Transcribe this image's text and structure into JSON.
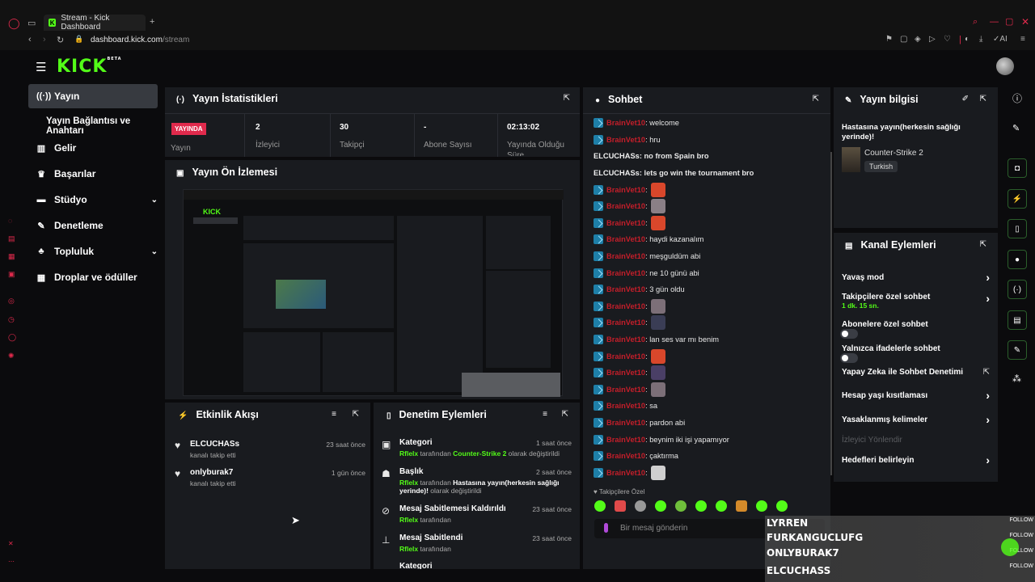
{
  "browser": {
    "tab_title": "Stream - Kick Dashboard",
    "url_host": "dashboard.kick.com",
    "url_path": "/stream",
    "ai_label": "AI"
  },
  "brand": {
    "logo": "KICK",
    "beta": "BETA"
  },
  "sidebar": {
    "items": [
      {
        "label": "Yayın",
        "icon": "broadcast-icon"
      },
      {
        "label": "Yayın Bağlantısı ve Anahtarı"
      },
      {
        "label": "Gelir",
        "icon": "chart-icon"
      },
      {
        "label": "Başarılar",
        "icon": "trophy-icon"
      },
      {
        "label": "Stüdyo",
        "icon": "studio-icon"
      },
      {
        "label": "Denetleme",
        "icon": "wrench-icon"
      },
      {
        "label": "Topluluk",
        "icon": "community-icon"
      },
      {
        "label": "Droplar ve ödüller",
        "icon": "gift-icon"
      }
    ]
  },
  "stats": {
    "title": "Yayın İstatistikleri",
    "live_badge": "YAYINDA",
    "live_label": "Yayın",
    "items": [
      {
        "value": "2",
        "label": "İzleyici"
      },
      {
        "value": "30",
        "label": "Takipçi"
      },
      {
        "value": "-",
        "label": "Abone Sayısı"
      },
      {
        "value": "02:13:02",
        "label": "Yayında Olduğu Süre"
      }
    ]
  },
  "preview": {
    "title": "Yayın Ön İzlemesi"
  },
  "activity": {
    "title": "Etkinlik Akışı",
    "items": [
      {
        "name": "ELCUCHASs",
        "sub": "kanalı takip etti",
        "time": "23 saat önce"
      },
      {
        "name": "onlyburak7",
        "sub": "kanalı takip etti",
        "time": "1 gün önce"
      }
    ]
  },
  "moderation": {
    "title": "Denetim Eylemleri",
    "items": [
      {
        "title": "Kategori",
        "user": "Rflelx",
        "mid": " tarafından ",
        "val": "Counter-Strike 2",
        "tail": " olarak değiştirildi",
        "time": "1 saat önce"
      },
      {
        "title": "Başlık",
        "user": "Rflelx",
        "mid": " tarafından ",
        "val": "Hastasına yayın(herkesin sağlığı yerinde)!",
        "tail": " olarak değiştirildi",
        "time": "2 saat önce"
      },
      {
        "title": "Mesaj Sabitlemesi Kaldırıldı",
        "user": "Rflelx",
        "mid": " tarafından",
        "val": "",
        "tail": "",
        "time": "23 saat önce"
      },
      {
        "title": "Mesaj Sabitlendi",
        "user": "Rflelx",
        "mid": " tarafından",
        "val": "",
        "tail": "",
        "time": "23 saat önce"
      },
      {
        "title": "Kategori",
        "user": "",
        "mid": "",
        "val": "",
        "tail": "",
        "time": ""
      }
    ]
  },
  "chat": {
    "title": "Sohbet",
    "placeholder": "Bir mesaj gönderin",
    "followers_only": "Takipçilere Özel",
    "messages": [
      {
        "user": "BrainVet10",
        "badge": true,
        "text": ": welcome"
      },
      {
        "user": "BrainVet10",
        "badge": true,
        "text": ": hru"
      },
      {
        "user": "ELCUCHASs",
        "badge": false,
        "text": ": no from Spain bro"
      },
      {
        "user": "ELCUCHASs",
        "badge": false,
        "text": ": lets go win the tournament bro"
      },
      {
        "user": "BrainVet10",
        "badge": true,
        "text": ":",
        "emote": "#d9472b"
      },
      {
        "user": "BrainVet10",
        "badge": true,
        "text": ":",
        "emote": "#8a7f86"
      },
      {
        "user": "BrainVet10",
        "badge": true,
        "text": ":",
        "emote": "#d9472b"
      },
      {
        "user": "BrainVet10",
        "badge": true,
        "text": ": haydi kazanalım"
      },
      {
        "user": "BrainVet10",
        "badge": true,
        "text": ": meşguldüm abi"
      },
      {
        "user": "BrainVet10",
        "badge": true,
        "text": ": ne 10 günü abi"
      },
      {
        "user": "BrainVet10",
        "badge": true,
        "text": ": 3 gün oldu"
      },
      {
        "user": "BrainVet10",
        "badge": true,
        "text": ":",
        "emote": "#7c6f78"
      },
      {
        "user": "BrainVet10",
        "badge": true,
        "text": ":",
        "emote": "#3a3d55"
      },
      {
        "user": "BrainVet10",
        "badge": true,
        "text": ": lan ses var mı benim"
      },
      {
        "user": "BrainVet10",
        "badge": true,
        "text": ":",
        "emote": "#d9472b"
      },
      {
        "user": "BrainVet10",
        "badge": true,
        "text": ":",
        "emote": "#4a3f66"
      },
      {
        "user": "BrainVet10",
        "badge": true,
        "text": ":",
        "emote": "#7c6f78"
      },
      {
        "user": "BrainVet10",
        "badge": true,
        "text": ": sa"
      },
      {
        "user": "BrainVet10",
        "badge": true,
        "text": ": pardon abi"
      },
      {
        "user": "BrainVet10",
        "badge": true,
        "text": ": beynim iki işi yapamıyor"
      },
      {
        "user": "BrainVet10",
        "badge": true,
        "text": ": çaktırma"
      },
      {
        "user": "BrainVet10",
        "badge": true,
        "text": ":",
        "emote": "#cfcfcf"
      }
    ]
  },
  "stream_info": {
    "title": "Yayın bilgisi",
    "stream_title": "Hastasına yayın(herkesin sağlığı yerinde)!",
    "category": "Counter-Strike 2",
    "language": "Turkish"
  },
  "channel_actions": {
    "title": "Kanal Eylemleri",
    "items": [
      {
        "label": "Yavaş mod",
        "sub": "",
        "control": "chevron"
      },
      {
        "label": "Takipçilere özel sohbet",
        "sub": "1 dk. 15 sn.",
        "control": "chevron"
      },
      {
        "label": "Abonelere özel sohbet",
        "sub": "",
        "control": "toggle"
      },
      {
        "label": "Yalnızca ifadelerle sohbet",
        "sub": "",
        "control": "toggle"
      },
      {
        "label": "Yapay Zeka ile Sohbet Denetimi",
        "sub": "",
        "control": "external"
      },
      {
        "label": "Hesap yaşı kısıtlaması",
        "sub": "",
        "control": "chevron"
      },
      {
        "label": "Yasaklanmış kelimeler",
        "sub": "",
        "control": "chevron"
      },
      {
        "label": "İzleyici Yönlendir",
        "sub": "",
        "control": "disabled"
      },
      {
        "label": "Hedefleri belirleyin",
        "sub": "",
        "control": "chevron"
      }
    ]
  },
  "overlay": {
    "follow": "FOLLOW",
    "names": [
      "LYRREN",
      "FURKANGUCLUFG",
      "ONLYBURAK7",
      "ELCUCHASS"
    ]
  },
  "colors": {
    "accent": "#53fc18",
    "live": "#e02a4c",
    "username": "#ff1f2e"
  }
}
